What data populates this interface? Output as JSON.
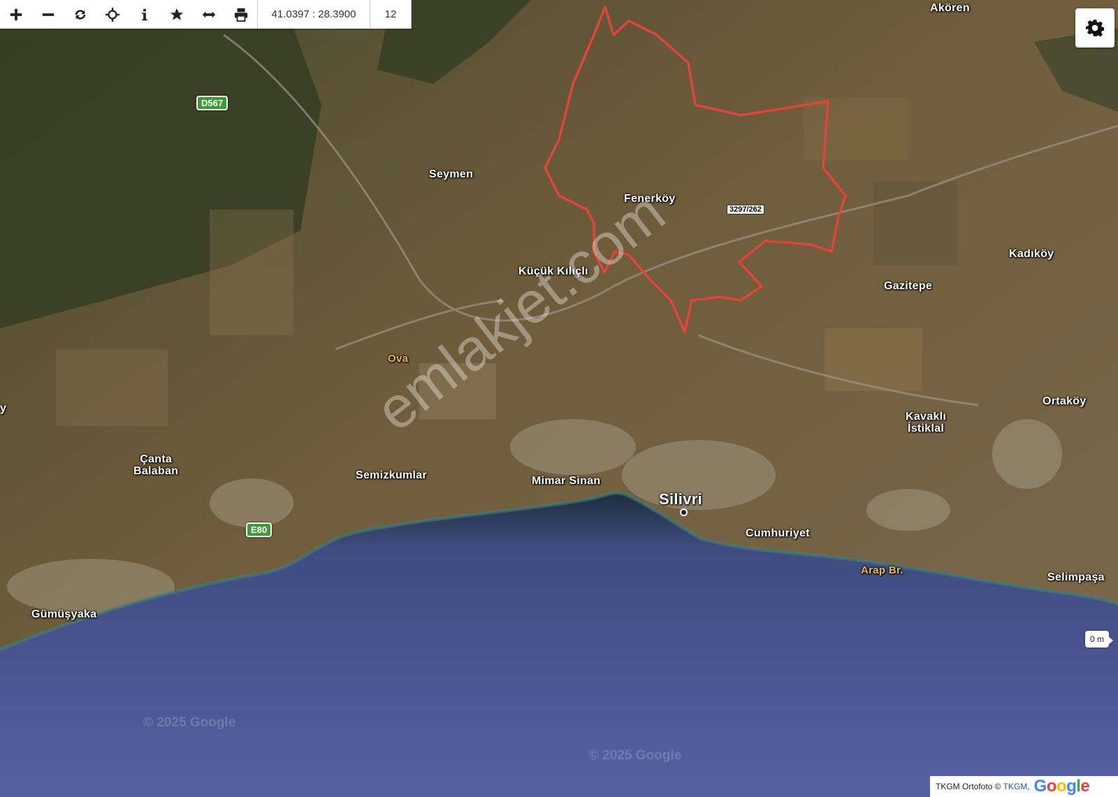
{
  "toolbar": {
    "buttons": [
      {
        "name": "zoom-in",
        "icon": "plus-icon"
      },
      {
        "name": "zoom-out",
        "icon": "minus-icon"
      },
      {
        "name": "refresh",
        "icon": "refresh-icon"
      },
      {
        "name": "locate",
        "icon": "crosshair-icon"
      },
      {
        "name": "info",
        "icon": "info-icon"
      },
      {
        "name": "favorite",
        "icon": "star-icon"
      },
      {
        "name": "measure",
        "icon": "horizontal-arrows-icon"
      },
      {
        "name": "print",
        "icon": "print-icon"
      }
    ],
    "coordinates": "41.0397 : 28.3900",
    "zoom_level": "12"
  },
  "settings": {
    "icon": "gear-icon"
  },
  "map": {
    "places": {
      "akoren": "Akören",
      "seymen": "Seymen",
      "fenerkoy": "Fenerköy",
      "kucuk_kilicli": "Küçük Kılıçlı",
      "kadikoy": "Kadıköy",
      "gazitepe": "Gazitepe",
      "ova": "Ova",
      "ortakoy": "Ortaköy",
      "kavakli_istiklal": "Kavaklı\nİstiklal",
      "canta_balaban": "Çanta\nBalaban",
      "semizkumlar": "Semizkumlar",
      "mimar_sinan": "Mimar Sinan",
      "silivri": "Silivri",
      "cumhuriyet": "Cumhuriyet",
      "arap_br": "Arap Br.",
      "selimpasa": "Selimpaşa",
      "gumusyaka": "Gümüşyaka",
      "edge_y": "y"
    },
    "road_shields": {
      "d567": "D567",
      "e80": "E80"
    },
    "parcel_label": "3297/262",
    "watermark": "emlakjet.com",
    "google_watermark": "© 2025 Google",
    "scale": "0 m",
    "colors": {
      "parcel_outline": "#e0453a",
      "sea": "#4f5c9a",
      "land": "#6c5b3a"
    }
  },
  "attribution": {
    "text": "TKGM Ortofoto ©",
    "link": "TKGM",
    "separator": ",",
    "brand": "Google"
  }
}
